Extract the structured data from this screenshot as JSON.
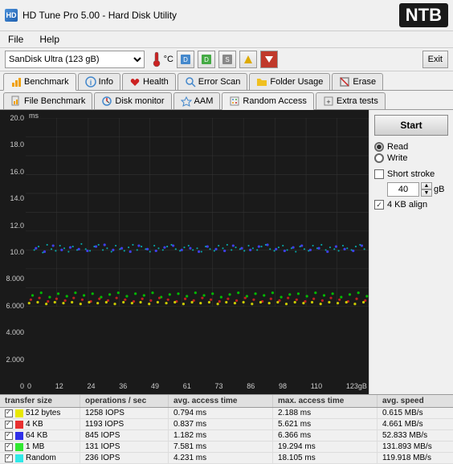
{
  "title": "HD Tune Pro 5.00 - Hard Disk Utility",
  "ntb": "NTB",
  "menu": {
    "file": "File",
    "help": "Help"
  },
  "toolbar": {
    "drive": "SanDisk Ultra (123 gB)",
    "temp_unit": "°C",
    "exit": "Exit"
  },
  "tabs_row1": [
    {
      "label": "Benchmark",
      "icon": "benchmark"
    },
    {
      "label": "Info",
      "icon": "info"
    },
    {
      "label": "Health",
      "icon": "health"
    },
    {
      "label": "Error Scan",
      "icon": "errorscan"
    },
    {
      "label": "Folder Usage",
      "icon": "folder"
    },
    {
      "label": "Erase",
      "icon": "erase"
    }
  ],
  "tabs_row2": [
    {
      "label": "File Benchmark",
      "icon": "filebenchmark"
    },
    {
      "label": "Disk monitor",
      "icon": "diskmonitor"
    },
    {
      "label": "AAM",
      "icon": "aam"
    },
    {
      "label": "Random Access",
      "icon": "randomaccess"
    },
    {
      "label": "Extra tests",
      "icon": "extratests"
    }
  ],
  "active_tab1": "Benchmark",
  "active_tab2": "Random Access",
  "chart": {
    "ms_label": "ms",
    "y_axis": [
      "20.0",
      "18.0",
      "16.0",
      "14.0",
      "12.0",
      "10.0",
      "8.000",
      "6.000",
      "4.000",
      "2.000",
      "0"
    ],
    "x_axis": [
      "0",
      "12",
      "24",
      "36",
      "49",
      "61",
      "73",
      "86",
      "98",
      "110",
      "123gB"
    ]
  },
  "right_panel": {
    "start_label": "Start",
    "read_label": "Read",
    "write_label": "Write",
    "short_stroke_label": "Short stroke",
    "short_stroke_value": "40",
    "gb_label": "gB",
    "kb_align_label": "4 KB align",
    "read_checked": true,
    "write_checked": false,
    "short_stroke_checked": false,
    "kb_align_checked": true
  },
  "table": {
    "headers": [
      "transfer size",
      "operations / sec",
      "avg. access time",
      "max. access time",
      "avg. speed"
    ],
    "rows": [
      {
        "color": "#e8e800",
        "label": "512 bytes",
        "ops": "1258 IOPS",
        "avg_access": "0.794 ms",
        "max_access": "2.188 ms",
        "avg_speed": "0.615 MB/s"
      },
      {
        "color": "#e83030",
        "label": "4 KB",
        "ops": "1193 IOPS",
        "avg_access": "0.837 ms",
        "max_access": "5.621 ms",
        "avg_speed": "4.661 MB/s"
      },
      {
        "color": "#3030e8",
        "label": "64 KB",
        "ops": "845 IOPS",
        "avg_access": "1.182 ms",
        "max_access": "6.366 ms",
        "avg_speed": "52.833 MB/s"
      },
      {
        "color": "#30e830",
        "label": "1 MB",
        "ops": "131 IOPS",
        "avg_access": "7.581 ms",
        "max_access": "19.294 ms",
        "avg_speed": "131.893 MB/s"
      },
      {
        "color": "#30e8e8",
        "label": "Random",
        "ops": "236 IOPS",
        "avg_access": "4.231 ms",
        "max_access": "18.105 ms",
        "avg_speed": "119.918 MB/s"
      }
    ]
  }
}
